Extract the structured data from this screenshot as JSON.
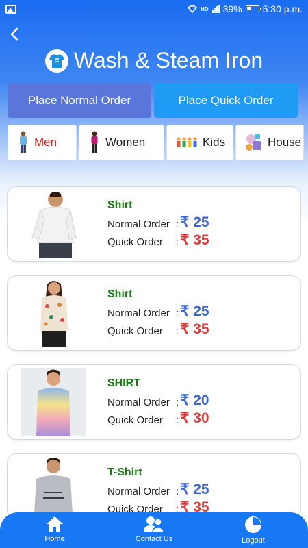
{
  "status_bar": {
    "network_badge": "HD",
    "battery": "39%",
    "time": "5:30 p.m."
  },
  "header": {
    "title": "Wash & Steam Iron",
    "title_icon": "tshirt-icon",
    "back_icon": "back-arrow-icon"
  },
  "order_buttons": {
    "normal": "Place Normal Order",
    "quick": "Place Quick Order"
  },
  "categories": [
    {
      "label": "Men",
      "icon": "man-figure-icon",
      "active": true
    },
    {
      "label": "Women",
      "icon": "woman-figure-icon",
      "active": false
    },
    {
      "label": "Kids",
      "icon": "kids-group-icon",
      "active": false
    },
    {
      "label": "House",
      "icon": "household-items-icon",
      "active": false
    }
  ],
  "items": [
    {
      "name": "Shirt",
      "normal_label": "Normal Order",
      "quick_label": "Quick Order",
      "normal_price": "₹ 25",
      "quick_price": "₹ 35",
      "image": "man-white-shirt-photo"
    },
    {
      "name": "Shirt",
      "normal_label": "Normal Order",
      "quick_label": "Quick Order",
      "normal_price": "₹ 25",
      "quick_price": "₹ 35",
      "image": "woman-floral-shirt-photo"
    },
    {
      "name": "SHIRT",
      "normal_label": "Normal Order",
      "quick_label": "Quick Order",
      "normal_price": "₹ 20",
      "quick_price": "₹ 30",
      "image": "boy-gradient-shirt-photo"
    },
    {
      "name": "T-Shirt",
      "normal_label": "Normal Order",
      "quick_label": "Quick Order",
      "normal_price": "₹ 25",
      "quick_price": "₹ 35",
      "image": "man-grey-tshirt-photo"
    }
  ],
  "bottom_nav": {
    "home": "Home",
    "contact": "Contact Us",
    "logout": "Logout"
  },
  "colors": {
    "primary": "#1877f2",
    "normal_button": "#5a76da",
    "quick_button": "#1f9bf5",
    "item_name": "#1e7a17",
    "normal_price": "#3f64d3",
    "quick_price": "#e03b3b",
    "active_category": "#d21d1d"
  }
}
